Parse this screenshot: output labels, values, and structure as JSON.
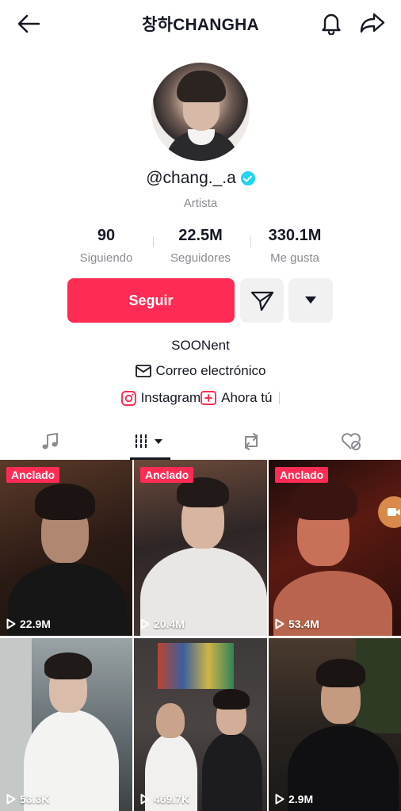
{
  "header": {
    "title": "창하CHANGHA"
  },
  "profile": {
    "handle": "@chang._.a",
    "category": "Artista",
    "stats": [
      {
        "value": "90",
        "label": "Siguiendo"
      },
      {
        "value": "22.5M",
        "label": "Seguidores"
      },
      {
        "value": "330.1M",
        "label": "Me gusta"
      }
    ],
    "follow_label": "Seguir",
    "bio": "SOONent",
    "email_label": "Correo electrónico",
    "instagram_label": "Instagram",
    "ahora_label": "Ahora tú"
  },
  "tabs": [
    {
      "icon": "music-note-icon"
    },
    {
      "icon": "grid-icon",
      "selected": true
    },
    {
      "icon": "repost-icon"
    },
    {
      "icon": "liked-hidden-icon"
    }
  ],
  "videos": [
    {
      "pinned": "Anclado",
      "views": "22.9M"
    },
    {
      "pinned": "Anclado",
      "views": "20.4M"
    },
    {
      "pinned": "Anclado",
      "views": "53.4M"
    },
    {
      "views": "53.3K"
    },
    {
      "views": "469.7K"
    },
    {
      "views": "2.9M"
    }
  ],
  "colors": {
    "accent": "#fe2c55",
    "verified": "#20d5ec",
    "secondary_text": "#8a8b91",
    "button_gray": "#f1f1f2"
  }
}
